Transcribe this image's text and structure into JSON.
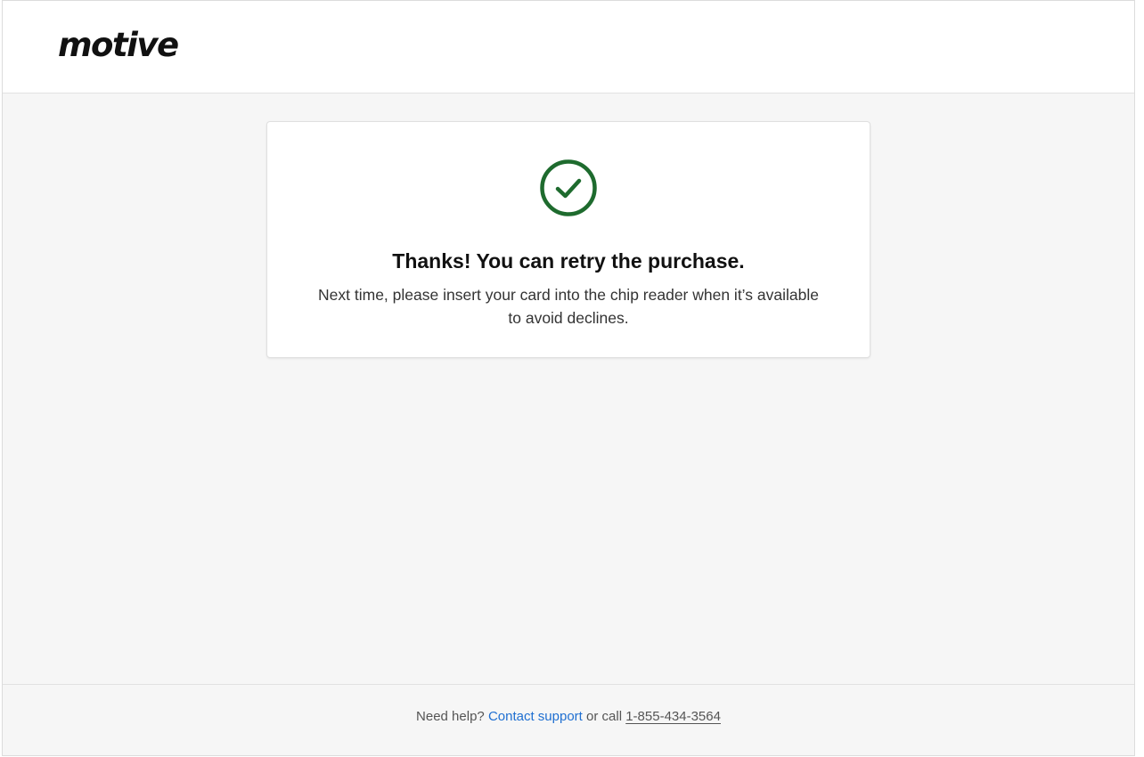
{
  "header": {
    "logo_text": "motive"
  },
  "confirmation": {
    "icon": "check-circle-icon",
    "icon_color": "#1e6b2e",
    "title": "Thanks! You can retry the purchase.",
    "message": "Next time, please insert your card into the chip reader when it’s available to avoid declines."
  },
  "footer": {
    "help_prefix": "Need help?",
    "contact_link": "Contact support",
    "call_text": "or call",
    "phone": "1-855-434-3564",
    "link_color": "#1f6fd1"
  }
}
